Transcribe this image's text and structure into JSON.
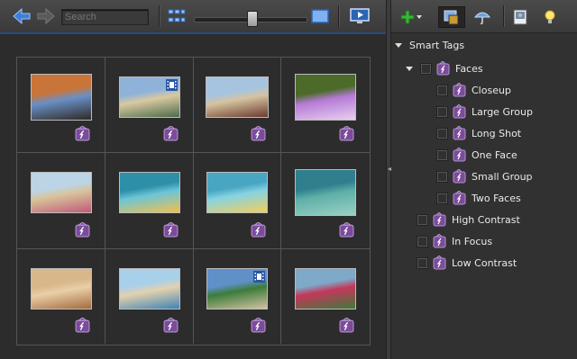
{
  "toolbar": {
    "search_placeholder": "Search",
    "icons": [
      "back-arrow-icon",
      "forward-arrow-icon",
      "grid-view-icon",
      "single-view-icon",
      "slideshow-monitor-icon"
    ]
  },
  "photo_grid": {
    "rows": 3,
    "columns": 4,
    "thumbnails": [
      {
        "subject": "palm trees beach hotel sunset",
        "video": false
      },
      {
        "subject": "beach shoreline",
        "video": true
      },
      {
        "subject": "person on beach",
        "video": false
      },
      {
        "subject": "purple orchid flower",
        "video": false
      },
      {
        "subject": "group of children on beach",
        "video": false
      },
      {
        "subject": "child swimming pool float",
        "video": false
      },
      {
        "subject": "child on pool float",
        "video": false
      },
      {
        "subject": "underwater swimmers",
        "video": false
      },
      {
        "subject": "child drinking coconut",
        "video": false
      },
      {
        "subject": "children at ocean shore",
        "video": false
      },
      {
        "subject": "resort pool with palms",
        "video": true
      },
      {
        "subject": "woman under umbrella",
        "video": false
      }
    ]
  },
  "right_toolbar": {
    "icons": [
      "add-tag-icon",
      "dropdown-caret-icon",
      "smart-tags-panel-icon",
      "umbrella-icon",
      "photo-info-icon",
      "lightbulb-icon"
    ]
  },
  "tags_panel": {
    "root_label": "Smart Tags",
    "faces": {
      "label": "Faces",
      "children": [
        "Closeup",
        "Large Group",
        "Long Shot",
        "One Face",
        "Small Group",
        "Two Faces"
      ]
    },
    "others": [
      "High Contrast",
      "In Focus",
      "Low Contrast"
    ]
  },
  "colors": {
    "accent_blue": "#1f4e8a",
    "tag_purple": "#7a4c9a",
    "add_green": "#3bb53b"
  }
}
